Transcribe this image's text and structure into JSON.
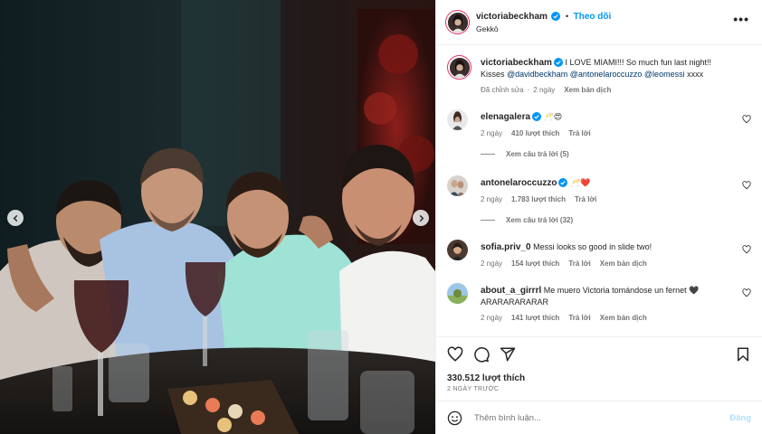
{
  "post": {
    "author": "victoriabeckham",
    "follow_label": "Theo dõi",
    "separator": "•",
    "location": "Gekkō",
    "more_label": "•••"
  },
  "caption": {
    "username": "victoriabeckham",
    "text": "I LOVE MIAMI!!! So much fun last night!! Kisses",
    "mentions": [
      "@davidbeckham",
      "@antonelaroccuzzo",
      "@leomessi"
    ],
    "tail": "xxxx",
    "edited": "Đã chỉnh sửa",
    "time": "2 ngày",
    "translate": "Xem bản dịch"
  },
  "comments": [
    {
      "username": "elenagalera",
      "text": "🥂😍",
      "verified": true,
      "time": "2 ngày",
      "likes": "410 lượt thích",
      "reply": "Trả lời",
      "view_replies": "Xem câu trả lời (5)"
    },
    {
      "username": "antonelaroccuzzo",
      "text": "🥂❤️",
      "verified": true,
      "time": "2 ngày",
      "likes": "1.783 lượt thích",
      "reply": "Trả lời",
      "view_replies": "Xem câu trả lời (32)"
    },
    {
      "username": "sofia.priv_0",
      "text": "Messi looks so good in slide two!",
      "verified": false,
      "time": "2 ngày",
      "likes": "154 lượt thích",
      "reply": "Trả lời",
      "translate": "Xem bản dịch"
    },
    {
      "username": "about_a_girrrl",
      "text": "Me muero Victoria tomándose un fernet 🖤 ARARARARARAR",
      "verified": false,
      "time": "2 ngày",
      "likes": "141 lượt thích",
      "reply": "Trả lời",
      "translate": "Xem bản dịch"
    }
  ],
  "actions": {
    "icons": [
      "heart-icon",
      "comment-icon",
      "share-icon",
      "bookmark-icon"
    ],
    "likes": "330.512 lượt thích",
    "date": "2 NGÀY TRƯỚC"
  },
  "add_comment": {
    "placeholder": "Thêm bình luận...",
    "post_label": "Đăng"
  },
  "colors": {
    "accent": "#0095f6",
    "verified": "#0095f6",
    "muted": "#737373",
    "mention": "#00376b",
    "heart_red": "#ed4956"
  }
}
